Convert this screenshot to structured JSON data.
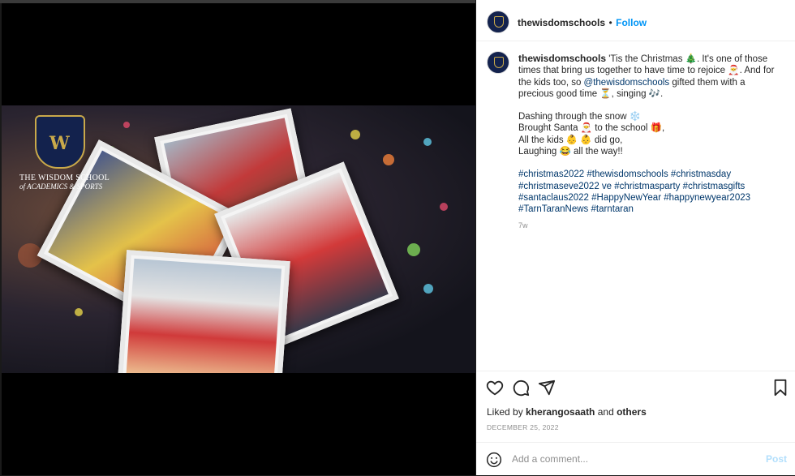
{
  "header": {
    "username": "thewisdomschools",
    "separator": "•",
    "follow_label": "Follow"
  },
  "media": {
    "logo_line1": "THE WISDOM SCHOOL",
    "logo_line2": "of ACADEMICS & SPORTS",
    "logo_mark": "W",
    "mute_icon_glyph": "🔇"
  },
  "caption": {
    "username": "thewisdomschools",
    "text1": " 'Tis the Christmas 🎄. It's one of those times that bring us together to have time to rejoice 🎅. And for the kids too, so ",
    "mention": "@thewisdomschools",
    "text2": " gifted them with a precious good time ⏳, singing 🎶.",
    "poem": [
      "Dashing through the snow ❄️",
      "Brought Santa 🎅 to the school 🎁,",
      "All the kids 👶 👶 did go,",
      "Laughing 😂 all the way!!"
    ],
    "hashtags": "#christmas2022 #thewisdomschools #christmasday #christmaseve2022 ve #christmasparty #christmasgifts #santaclaus2022 #HappyNewYear #happynewyear2023 #TarnTaranNews #tarntaran",
    "age": "7w"
  },
  "engagement": {
    "liked_by_prefix": "Liked by ",
    "liked_by_user": "kherangosaath",
    "and": " and ",
    "others": "others",
    "date": "DECEMBER 25, 2022"
  },
  "comment": {
    "placeholder": "Add a comment...",
    "post_label": "Post"
  },
  "colors": {
    "follow": "#0095f6",
    "post_disabled": "#b2dffc",
    "link": "#00376b"
  }
}
